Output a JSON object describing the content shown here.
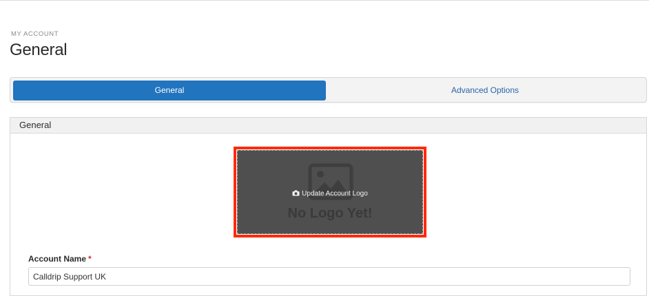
{
  "header": {
    "breadcrumb": "MY ACCOUNT",
    "title": "General"
  },
  "tabs": [
    {
      "label": "General",
      "active": true
    },
    {
      "label": "Advanced Options",
      "active": false
    }
  ],
  "panel": {
    "title": "General",
    "logo": {
      "update_label": "Update Account Logo",
      "placeholder_text": "No Logo Yet!",
      "icons": [
        "image-placeholder-icon",
        "camera-icon"
      ]
    },
    "account_name": {
      "label": "Account Name",
      "required_marker": "*",
      "value": "Calldrip Support UK"
    }
  },
  "colors": {
    "active_tab": "#2174be",
    "link": "#2a64a8",
    "highlight": "#ff2a00",
    "logo_bg": "#4f4f4f",
    "required": "#c9302c"
  }
}
